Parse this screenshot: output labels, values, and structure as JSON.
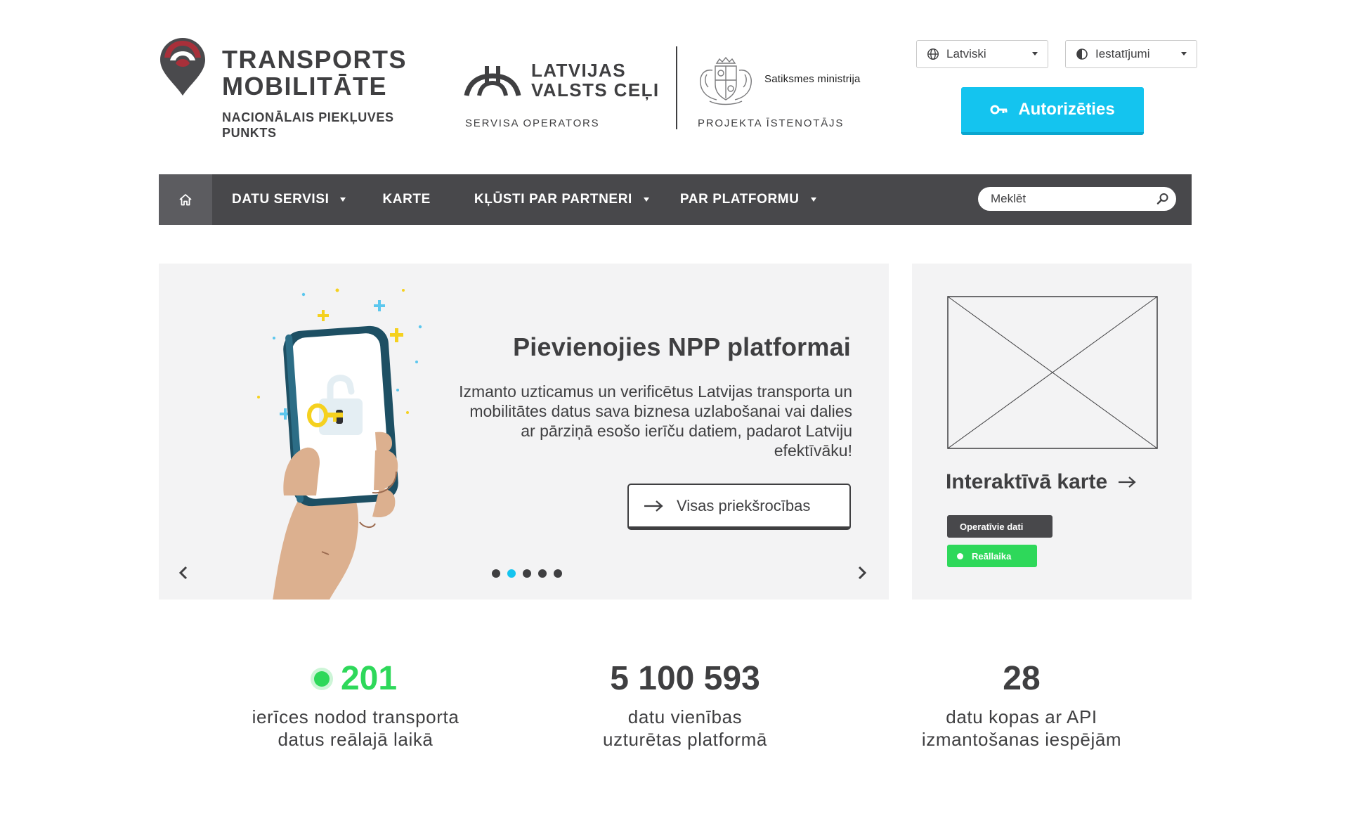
{
  "brand": {
    "title_line1": "TRANSPORTS",
    "title_line2": "MOBILITĀTE",
    "subtitle_line1": "NACIONĀLAIS PIEKĻUVES",
    "subtitle_line2": "PUNKTS"
  },
  "operator": {
    "name_line1": "LATVIJAS",
    "name_line2": "VALSTS CEĻI",
    "caption": "SERVISA OPERATORS"
  },
  "implementer": {
    "name": "Satiksmes ministrija",
    "caption": "PROJEKTA ĪSTENOTĀJS"
  },
  "controls": {
    "language": "Latviski",
    "settings": "Iestatījumi",
    "login": "Autorizēties"
  },
  "nav": {
    "items": [
      {
        "label": "DATU SERVISI"
      },
      {
        "label": "KARTE"
      },
      {
        "label": "KĻŪSTI PAR PARTNERI"
      },
      {
        "label": "PAR PLATFORMU"
      }
    ],
    "search_placeholder": "Meklēt"
  },
  "hero": {
    "title": "Pievienojies NPP platformai",
    "text": "Izmanto uzticamus un verificētus Latvijas transporta un mobilitātes datus sava biznesa uzlabošanai vai dalies ar pārziņā esošo ierīču datiem, padarot Latviju efektīvāku!",
    "button": "Visas priekšrocības",
    "slides_total": 5,
    "active_slide": 2
  },
  "map_card": {
    "title": "Interaktīvā karte",
    "badge_dark": "Operatīvie dati",
    "badge_green": "Reāllaika"
  },
  "stats": [
    {
      "value": "201",
      "label_line1": "ierīces nodod transporta",
      "label_line2": "datus reālajā laikā"
    },
    {
      "value": "5 100 593",
      "label_line1": "datu vienības",
      "label_line2": "uzturētas platformā"
    },
    {
      "value": "28",
      "label_line1": "datu kopas ar API",
      "label_line2": "izmantošanas iespējām"
    }
  ],
  "colors": {
    "accent": "#14c4ef",
    "dark": "#48484b",
    "text": "#3f3f41",
    "live_green": "#2ed85a",
    "brand_red": "#a8303a",
    "panel": "#f3f3f4"
  }
}
